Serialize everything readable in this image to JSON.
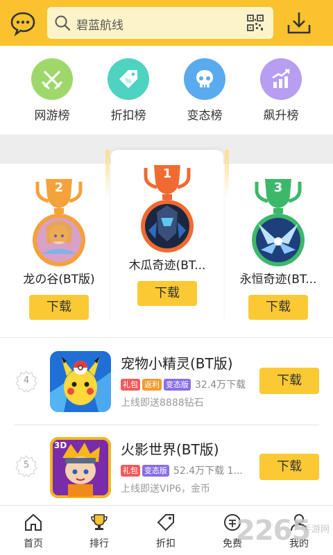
{
  "header": {
    "search_placeholder": "碧蓝航线",
    "icons": [
      "chat-icon",
      "search-icon",
      "qr-code-icon",
      "download-icon"
    ]
  },
  "categories": [
    {
      "label": "网游榜",
      "icon": "swords-icon",
      "color": "#9ed86a"
    },
    {
      "label": "折扣榜",
      "icon": "discount-tag-icon",
      "color": "#4fd3c1"
    },
    {
      "label": "变态榜",
      "icon": "skull-icon",
      "color": "#5aaaf0"
    },
    {
      "label": "飙升榜",
      "icon": "rising-chart-icon",
      "color": "#b79ef0"
    }
  ],
  "podium": [
    {
      "rank": "2",
      "name": "龙の谷(BT版)",
      "button": "下载",
      "medal_color": "#f4a23a"
    },
    {
      "rank": "1",
      "name": "木瓜奇迹(BT...",
      "button": "下载",
      "medal_color": "#f06a32"
    },
    {
      "rank": "3",
      "name": "永恒奇迹(BT...",
      "button": "下载",
      "medal_color": "#3cb86a"
    }
  ],
  "list": [
    {
      "rank": "4",
      "title": "宠物小精灵(BT版)",
      "tags": [
        "礼包",
        "返利",
        "变态版"
      ],
      "downloads": "32.4万下载",
      "promo": "上线即送8888钻石",
      "button": "下载"
    },
    {
      "rank": "5",
      "title": "火影世界(BT版)",
      "tags": [
        "礼包",
        "变态版"
      ],
      "downloads": "52.4万下载  1...",
      "promo": "上线即送VIP6，金币",
      "button": "下载"
    }
  ],
  "nav": [
    {
      "label": "首页",
      "icon": "home-icon"
    },
    {
      "label": "排行",
      "icon": "trophy-icon"
    },
    {
      "label": "折扣",
      "icon": "tag-icon"
    },
    {
      "label": "免费",
      "icon": "free-coin-icon"
    },
    {
      "label": "我的",
      "icon": "user-icon"
    }
  ],
  "watermark": {
    "number": "2265",
    "text": "手游网"
  },
  "colors": {
    "brand": "#f9c22e",
    "button": "#fbc934",
    "search_bg": "#fdf3c8"
  }
}
